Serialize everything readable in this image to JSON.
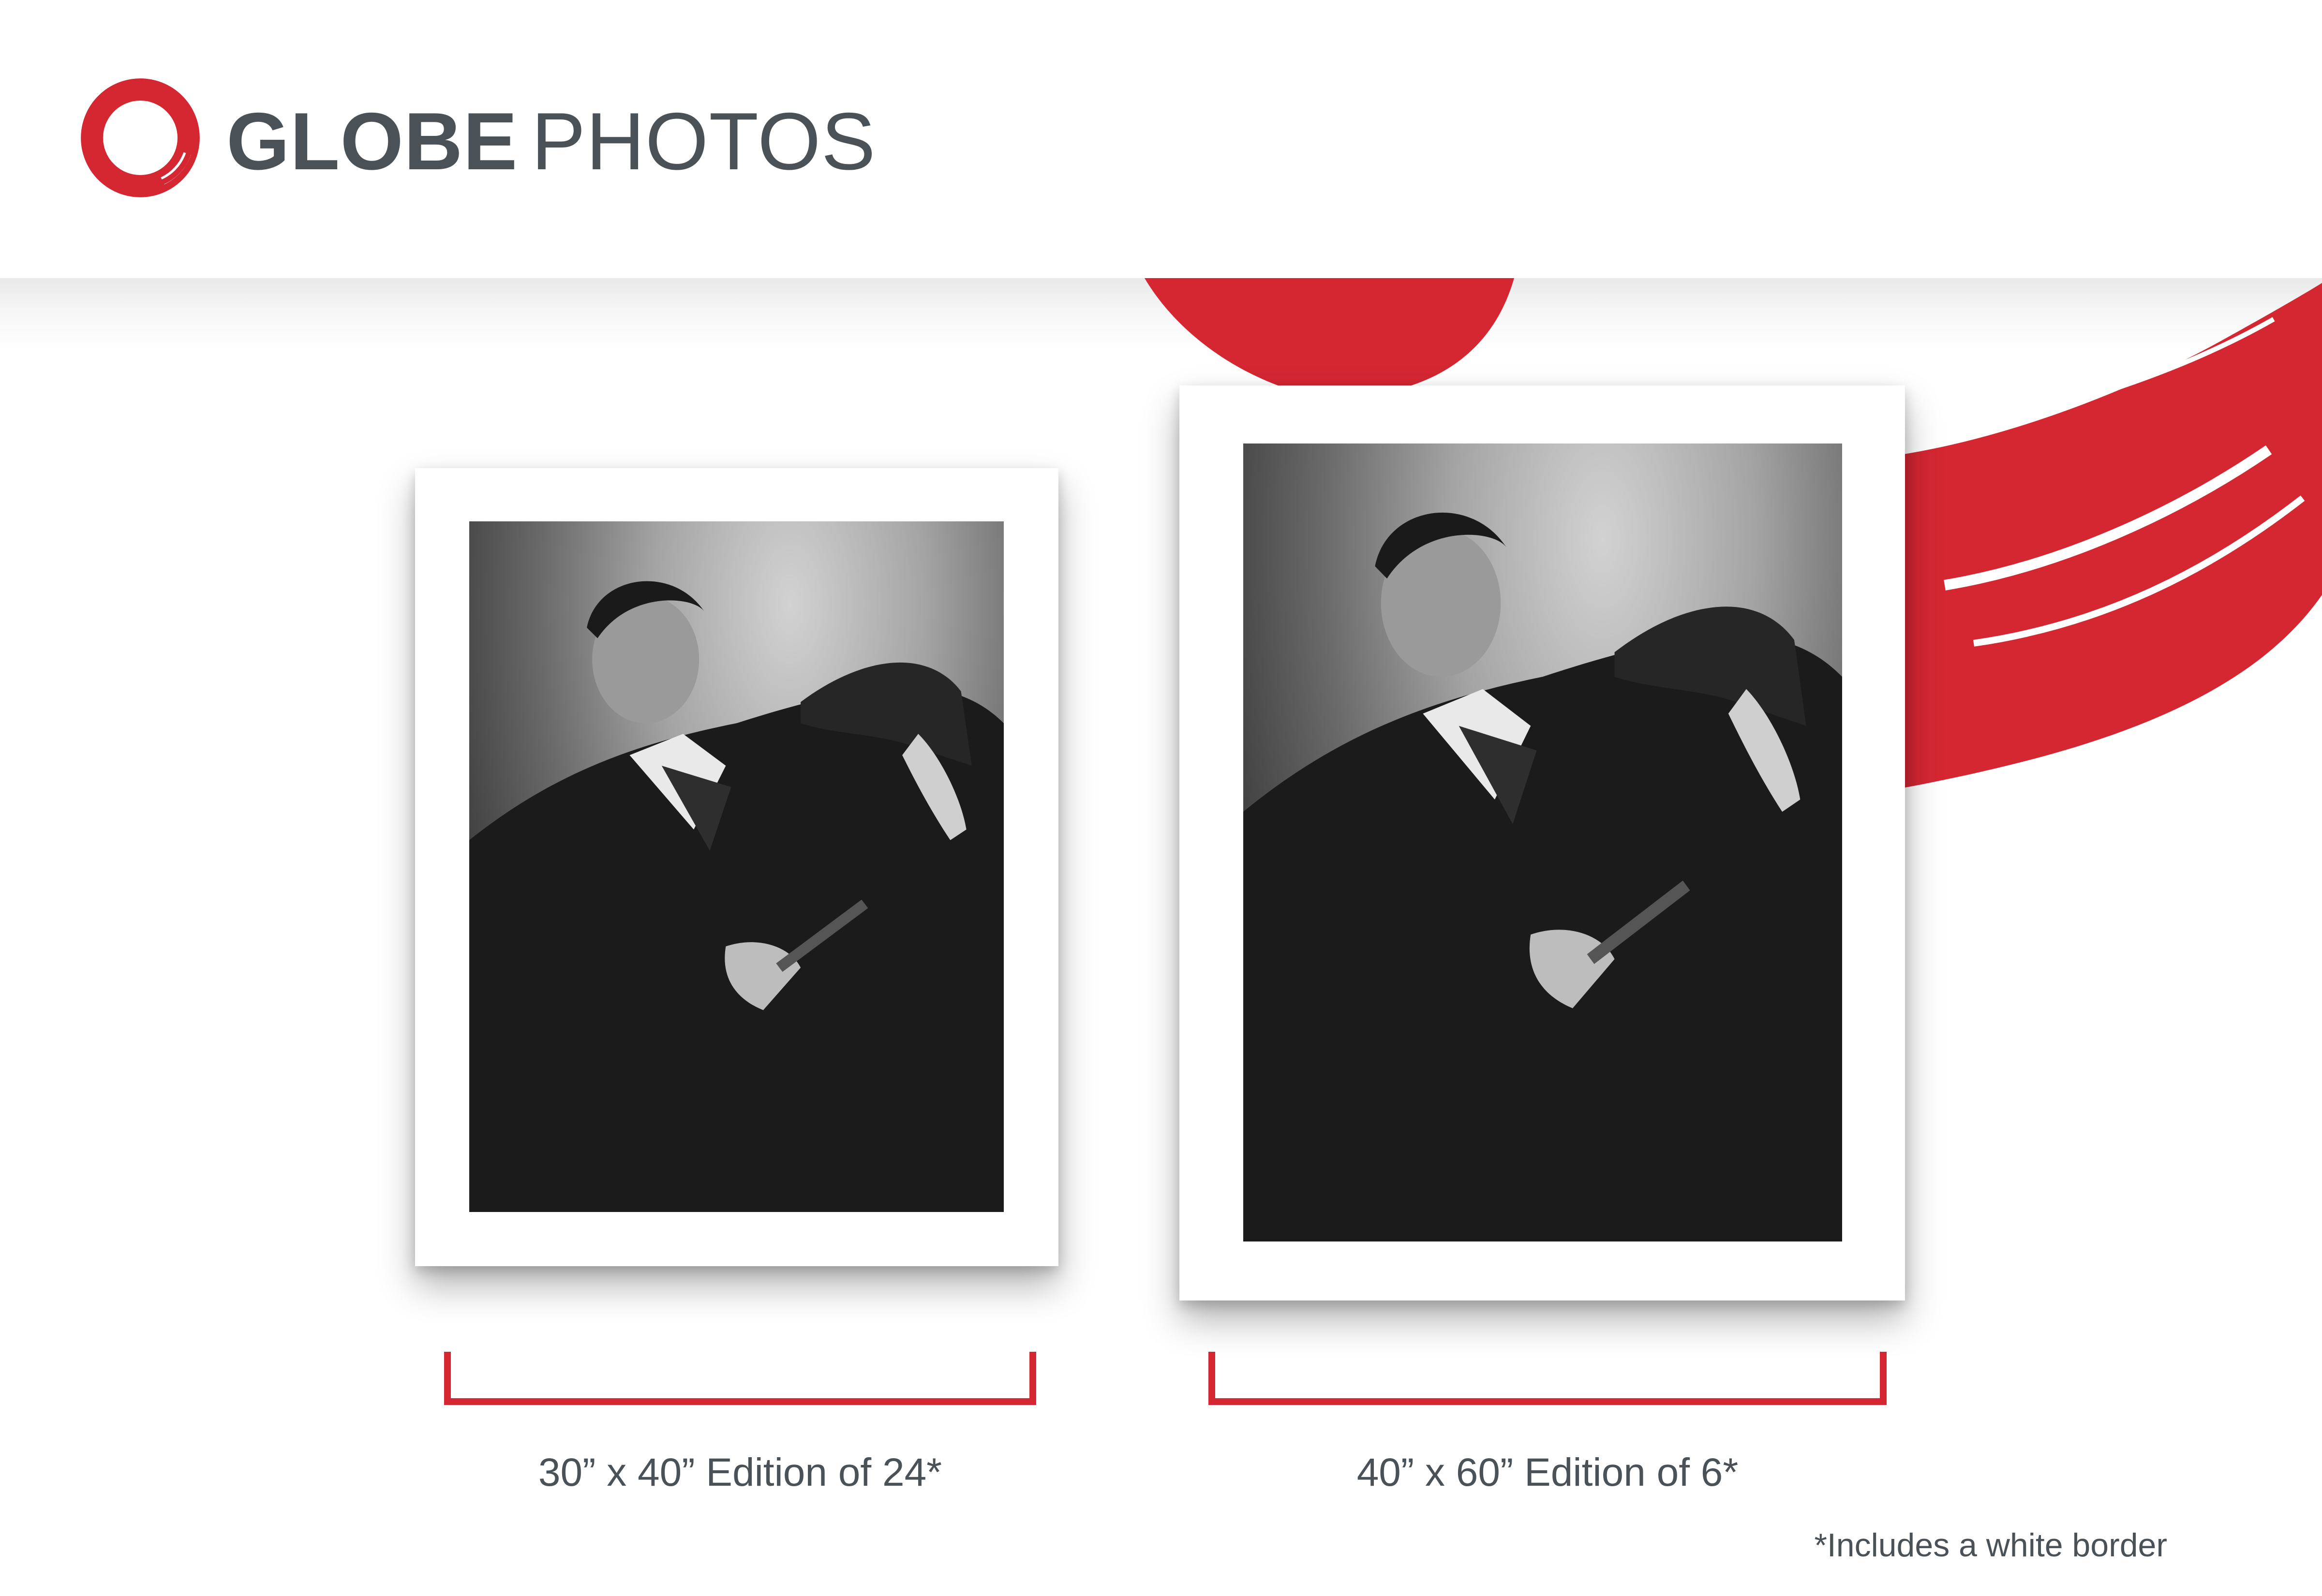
{
  "brand": {
    "name_bold": "GLOBE",
    "name_light": "PHOTOS"
  },
  "colors": {
    "accent": "#d42732",
    "text": "#4a5258"
  },
  "editions": [
    {
      "label": "30” x 40” Edition of 24*"
    },
    {
      "label": "40” x 60” Edition of 6*"
    }
  ],
  "footnote": "*Includes a white border"
}
